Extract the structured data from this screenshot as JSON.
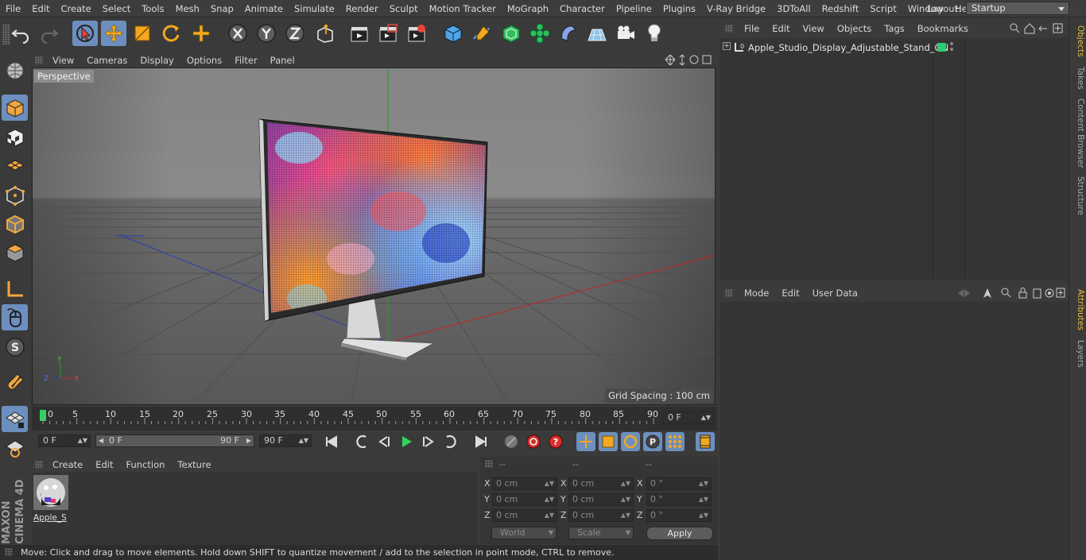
{
  "menubar": {
    "items": [
      "File",
      "Edit",
      "Create",
      "Select",
      "Tools",
      "Mesh",
      "Snap",
      "Animate",
      "Simulate",
      "Render",
      "Sculpt",
      "Motion Tracker",
      "MoGraph",
      "Character",
      "Pipeline",
      "Plugins",
      "V-Ray Bridge",
      "3DToAll",
      "Redshift",
      "Script",
      "Window",
      "Help"
    ],
    "layout_label": "Layout:",
    "layout_value": "Startup"
  },
  "viewport": {
    "menu": [
      "View",
      "Cameras",
      "Display",
      "Options",
      "Filter",
      "Panel"
    ],
    "camera_label": "Perspective",
    "grid_spacing": "Grid Spacing : 100 cm"
  },
  "timeline": {
    "ticks": [
      "0",
      "5",
      "10",
      "15",
      "20",
      "25",
      "30",
      "35",
      "40",
      "45",
      "50",
      "55",
      "60",
      "65",
      "70",
      "75",
      "80",
      "85",
      "90"
    ],
    "current_frame": "0 F"
  },
  "transport": {
    "start_field": "0 F",
    "range_start": "0 F",
    "range_end": "90 F",
    "end_field": "90 F"
  },
  "materials": {
    "menu": [
      "Create",
      "Edit",
      "Function",
      "Texture"
    ],
    "items": [
      {
        "label": "Apple_S"
      }
    ]
  },
  "coordinates": {
    "headers": [
      "--",
      "--",
      "--"
    ],
    "rows": [
      {
        "axis": "X",
        "pos": "0 cm",
        "size": "0 cm",
        "rot": "0 °"
      },
      {
        "axis": "Y",
        "pos": "0 cm",
        "size": "0 cm",
        "rot": "0 °"
      },
      {
        "axis": "Z",
        "pos": "0 cm",
        "size": "0 cm",
        "rot": "0 °"
      }
    ],
    "mode_select": "World",
    "scale_select": "Scale",
    "apply_label": "Apply"
  },
  "status": "Move: Click and drag to move elements. Hold down SHIFT to quantize movement / add to the selection in point mode, CTRL to remove.",
  "objects": {
    "menu": [
      "File",
      "Edit",
      "View",
      "Objects",
      "Tags",
      "Bookmarks"
    ],
    "items": [
      {
        "name": "Apple_Studio_Display_Adjustable_Stand_ON"
      }
    ]
  },
  "attributes": {
    "menu": [
      "Mode",
      "Edit",
      "User Data"
    ]
  },
  "right_tabs": [
    "Objects",
    "Takes",
    "Content Browser",
    "Structure",
    "Attributes",
    "Layers"
  ],
  "branding": "MAXON CINEMA 4D",
  "colors": {
    "accent": "#6c8fbf",
    "highlight_tab": "#e8b94a",
    "object_tag": "#2ecc71"
  }
}
